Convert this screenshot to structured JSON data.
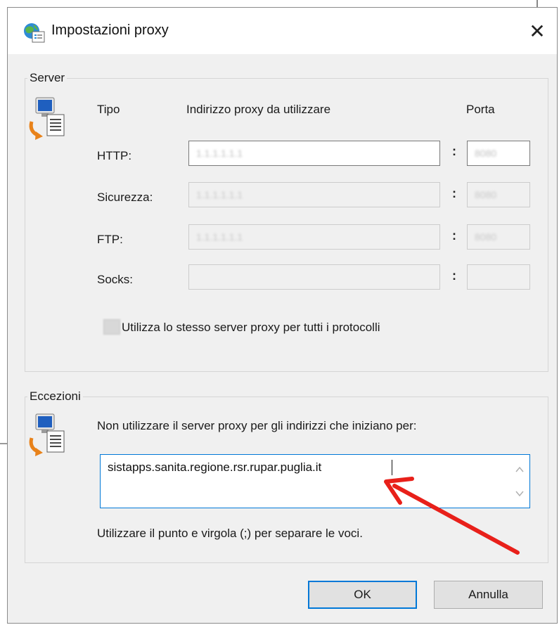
{
  "window": {
    "title": "Impostazioni proxy",
    "close_glyph": "✕"
  },
  "server": {
    "legend": "Server",
    "headers": {
      "type": "Tipo",
      "address": "Indirizzo proxy da utilizzare",
      "port": "Porta"
    },
    "rows": [
      {
        "label": "HTTP:",
        "address": "1.1.1.1.1.1",
        "port": "8080",
        "enabled": true
      },
      {
        "label": "Sicurezza:",
        "address": "1.1.1.1.1.1",
        "port": "8080",
        "enabled": false
      },
      {
        "label": "FTP:",
        "address": "1.1.1.1.1.1",
        "port": "8080",
        "enabled": false
      },
      {
        "label": "Socks:",
        "address": "",
        "port": "",
        "enabled": false
      }
    ],
    "colon": ":",
    "same_proxy_label": "Utilizza lo stesso server proxy per tutti i protocolli",
    "same_proxy_checked": true
  },
  "exceptions": {
    "legend": "Eccezioni",
    "description": "Non utilizzare il server proxy per gli indirizzi che iniziano per:",
    "value": "sistapps.sanita.regione.rsr.rupar.puglia.it",
    "hint": "Utilizzare il punto e virgola (;) per separare le voci."
  },
  "buttons": {
    "ok": "OK",
    "cancel": "Annulla"
  },
  "colors": {
    "accent": "#0078d7",
    "dialog_bg": "#f0f0f0",
    "annotation_arrow": "#e8201a"
  },
  "icons": {
    "app": "globe-settings-icon",
    "group": "computer-document-icon",
    "annotation": "red-arrow-icon"
  }
}
